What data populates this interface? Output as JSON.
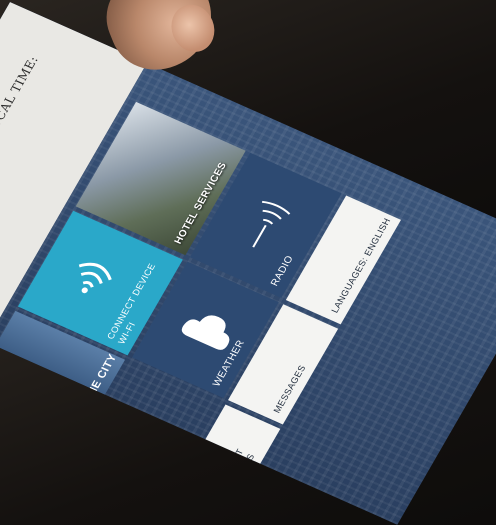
{
  "header": {
    "local_time_label": "LOCAL TIME:"
  },
  "tiles": {
    "hotel_services": {
      "label": "HOTEL SERVICES",
      "icon": "yacht-photo"
    },
    "radio": {
      "label": "RADIO",
      "icon": "radio-waves-icon"
    },
    "languages": {
      "label": "LANGUAGES: ENGLISH"
    },
    "wifi": {
      "label": "CONNECT DEVICE WI-FI",
      "icon": "wifi-icon"
    },
    "weather": {
      "label": "WEATHER",
      "icon": "cloud-icon"
    },
    "messages": {
      "label": "MESSAGES"
    },
    "explore": {
      "label": "ORE THE CITY",
      "icon": "city-skyline-photo"
    },
    "account": {
      "label": "ACCOUNT CHARGES"
    }
  },
  "colors": {
    "tile_dark_blue": "#2d4a72",
    "tile_cyan": "#2aa8c9",
    "tile_light": "#f4f4f2",
    "panel_light": "#e9e8e4"
  }
}
